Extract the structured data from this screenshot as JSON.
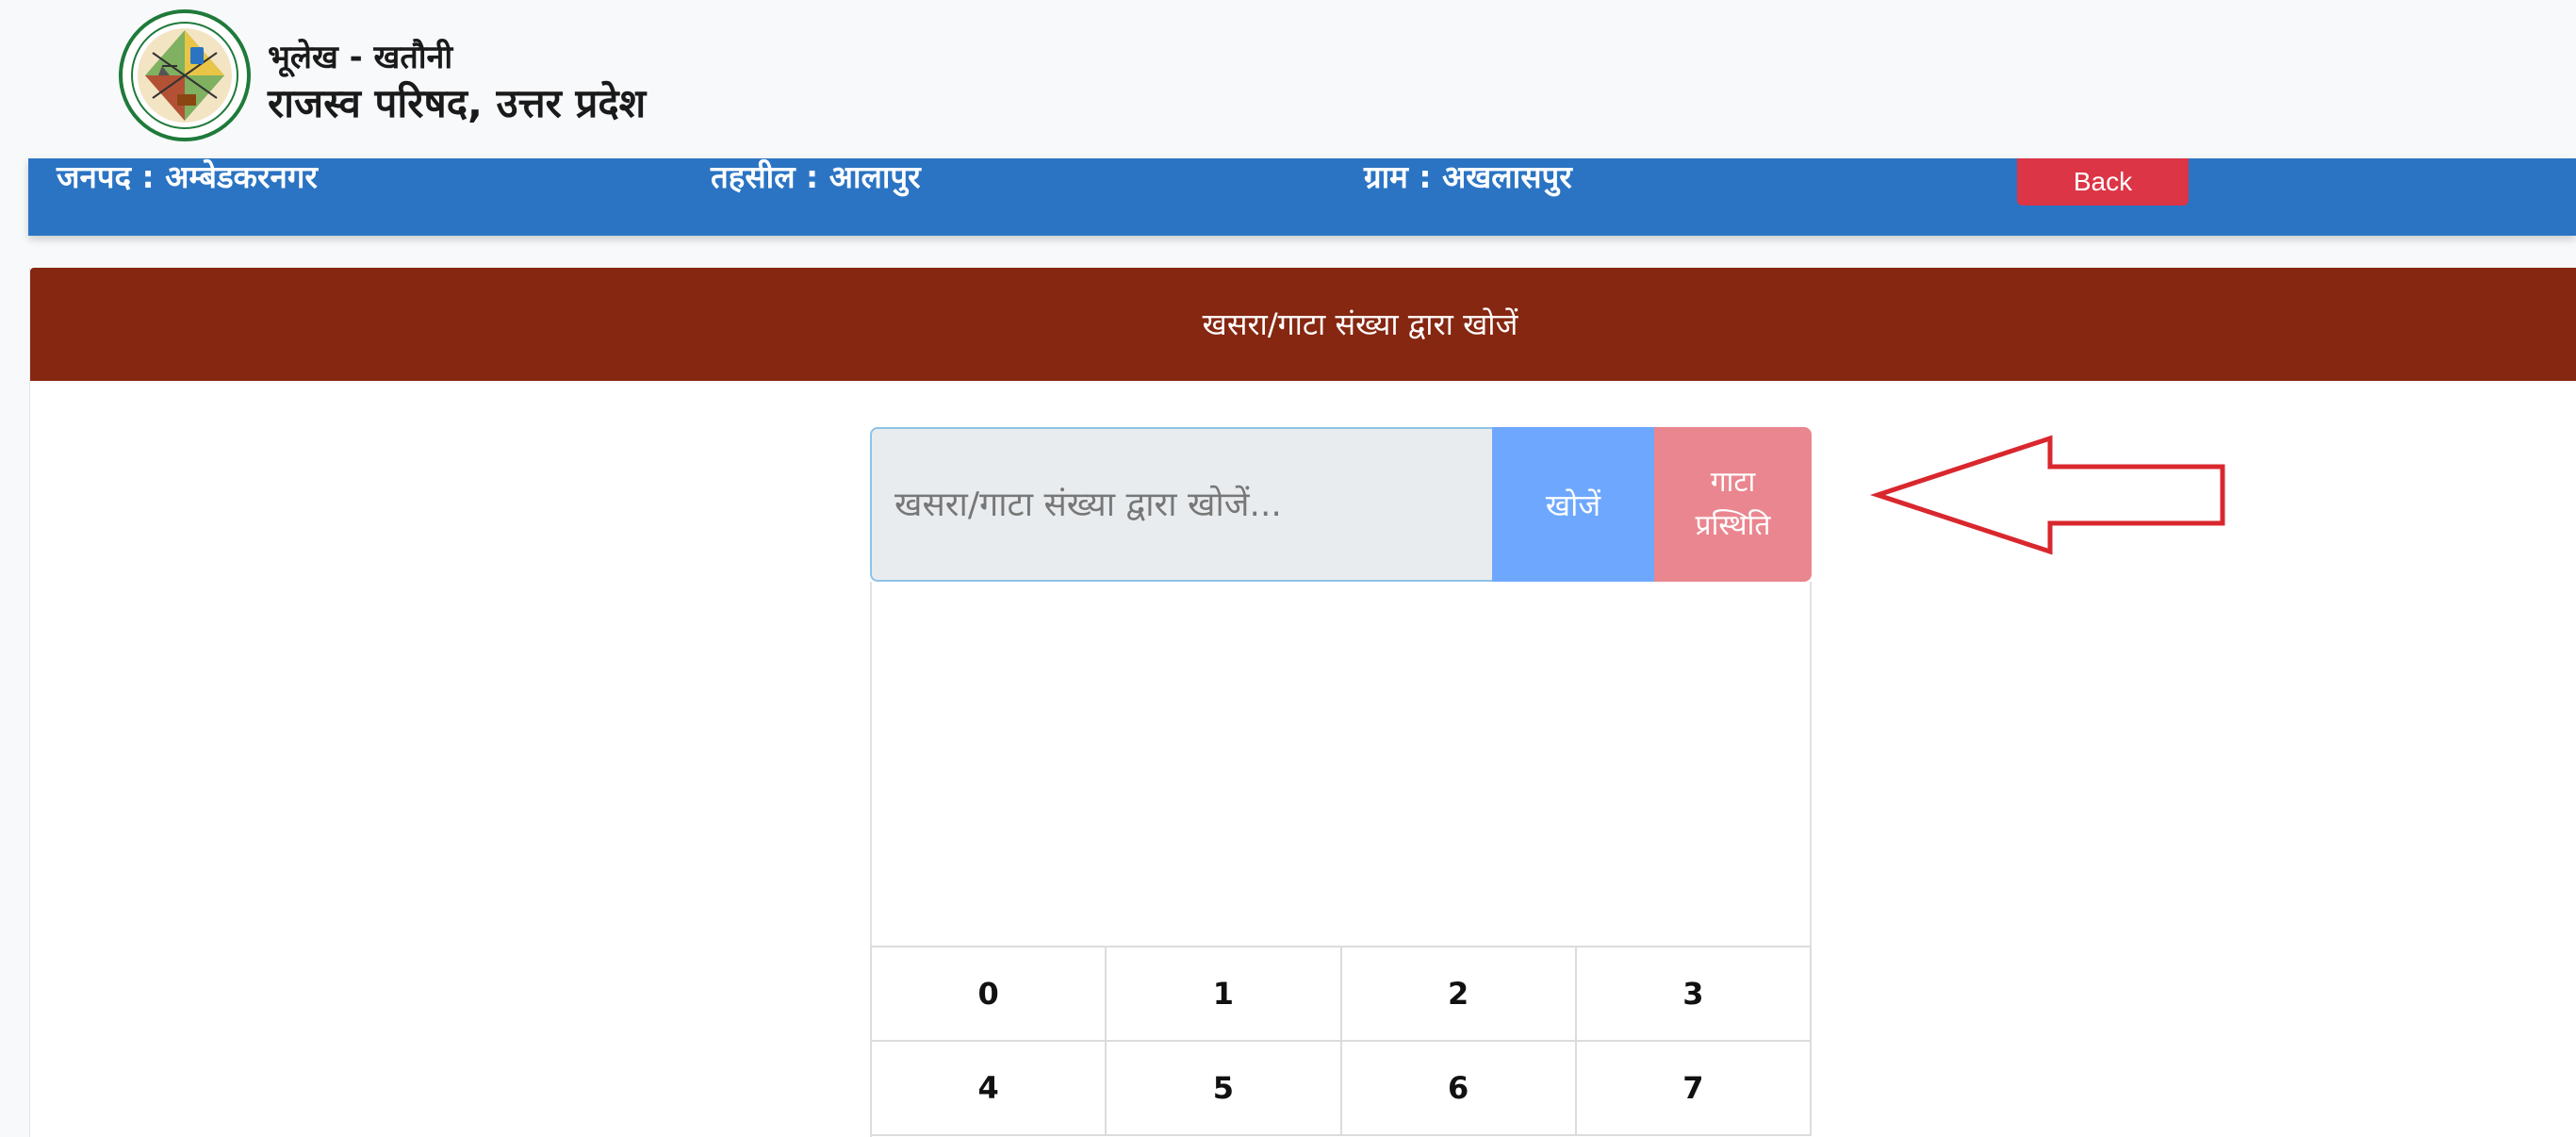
{
  "header": {
    "brand_line1": "भूलेख - खतौनी",
    "brand_line2": "राजस्व परिषद, उत्तर प्रदेश",
    "logo_icon": "revenue-board-seal-icon"
  },
  "location_bar": {
    "district": "जनपद : अम्बेडकरनगर",
    "tehsil": "तहसील : आलापुर",
    "village": "ग्राम : अखलासपुर",
    "back_label": "Back"
  },
  "search_card": {
    "title": "खसरा/गाटा संख्या द्वारा खोजें",
    "input_placeholder": "खसरा/गाटा संख्या द्वारा खोजें...",
    "input_value": "",
    "search_button": "खोजें",
    "status_button": "गाटा\nप्रस्थिति"
  },
  "keypad": {
    "keys": [
      "0",
      "1",
      "2",
      "3",
      "4",
      "5",
      "6",
      "7"
    ]
  },
  "colors": {
    "location_bar": "#2b74c3",
    "card_header": "#862711",
    "back_button": "#dc3545",
    "search_button": "#6ea8fe",
    "status_button": "#ea868f",
    "annotation_arrow": "#d9272e"
  }
}
